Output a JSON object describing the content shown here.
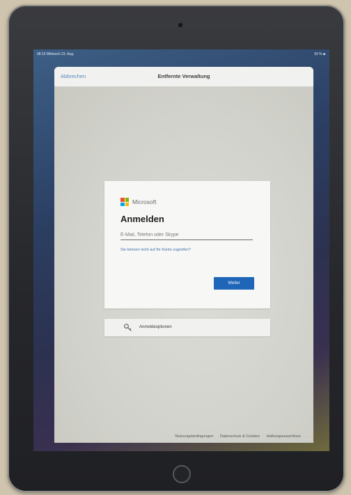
{
  "statusbar": {
    "time_date": "08:15  Mittwoch 23. Aug.",
    "battery": "93 % ■"
  },
  "navbar": {
    "cancel_label": "Abbrechen",
    "title": "Entfernte Verwaltung"
  },
  "login": {
    "brand": "Microsoft",
    "heading": "Anmelden",
    "email_placeholder": "E-Mail, Telefon oder Skype",
    "email_value": "",
    "help_link": "Sie können nicht auf Ihr Konto zugreifen?",
    "next_label": "Weiter"
  },
  "options": {
    "label": "Anmeldeoptionen",
    "icon": "key-icon"
  },
  "footer": {
    "terms": "Nutzungsbedingungen",
    "privacy": "Datenschutz & Cookies",
    "imprint": "Haftungsausschluss",
    "more": "..."
  },
  "colors": {
    "accent": "#1f66b8",
    "link": "#3f6fb0",
    "ms_red": "#f25022",
    "ms_green": "#7fba00",
    "ms_blue": "#00a4ef",
    "ms_yellow": "#ffb900"
  }
}
